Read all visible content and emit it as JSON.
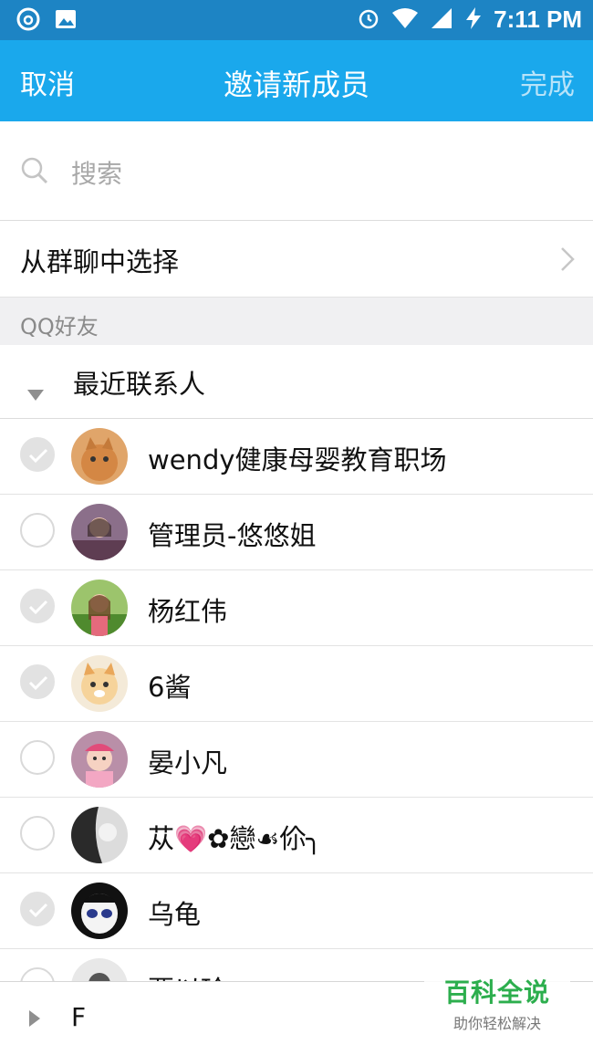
{
  "status_bar": {
    "time": "7:11 PM"
  },
  "nav": {
    "cancel": "取消",
    "title": "邀请新成员",
    "done": "完成"
  },
  "search": {
    "placeholder": "搜索"
  },
  "group_select": {
    "label": "从群聊中选择"
  },
  "section": {
    "label": "QQ好友"
  },
  "recent": {
    "label": "最近联系人"
  },
  "contacts": [
    {
      "name": "wendy健康母婴教育职场",
      "checked": true
    },
    {
      "name": "管理员-悠悠姐",
      "checked": false
    },
    {
      "name": "杨红伟",
      "checked": true
    },
    {
      "name": "6酱",
      "checked": true
    },
    {
      "name": "晏小凡",
      "checked": false
    },
    {
      "name": "苁💗✿戀☙伱╮",
      "checked": false
    },
    {
      "name": "乌龟",
      "checked": true
    },
    {
      "name": "贾以玲",
      "checked": false
    }
  ],
  "bottom_group": {
    "letter": "F"
  },
  "watermark": {
    "title": "百科全说",
    "subtitle": "助你轻松解决"
  },
  "colors": {
    "nav_bg": "#1aa8ec",
    "status_bg": "#1d84c4",
    "done_disabled": "#b7e3f9",
    "watermark_green": "#2cae4d"
  }
}
